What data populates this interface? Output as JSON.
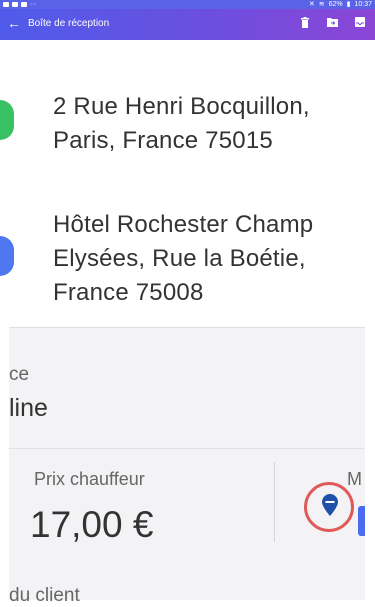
{
  "status_bar": {
    "battery": "62%",
    "time": "10:37"
  },
  "header": {
    "title": "Boîte de réception",
    "icons": [
      "back-arrow-icon",
      "trash-icon",
      "move-folder-icon",
      "inbox-icon"
    ]
  },
  "route": {
    "pickup_line1": "2 Rue Henri Bocquillon,",
    "pickup_line2": "Paris, France 75015",
    "dropoff_line1": "Hôtel Rochester Champ",
    "dropoff_line2": "Elysées, Rue la Boétie,",
    "dropoff_line3": "France 75008",
    "pickup_color": "#38c163",
    "dropoff_color": "#4f78ef"
  },
  "details": {
    "service_label_partial": "ce",
    "service_value_partial": "line",
    "price_label": "Prix chauffeur",
    "price_value": "17,00 €",
    "other_label_partial": "M",
    "client_label_partial": "du client"
  },
  "accent": "#5a62e8",
  "highlight_color": "#e05a5a"
}
